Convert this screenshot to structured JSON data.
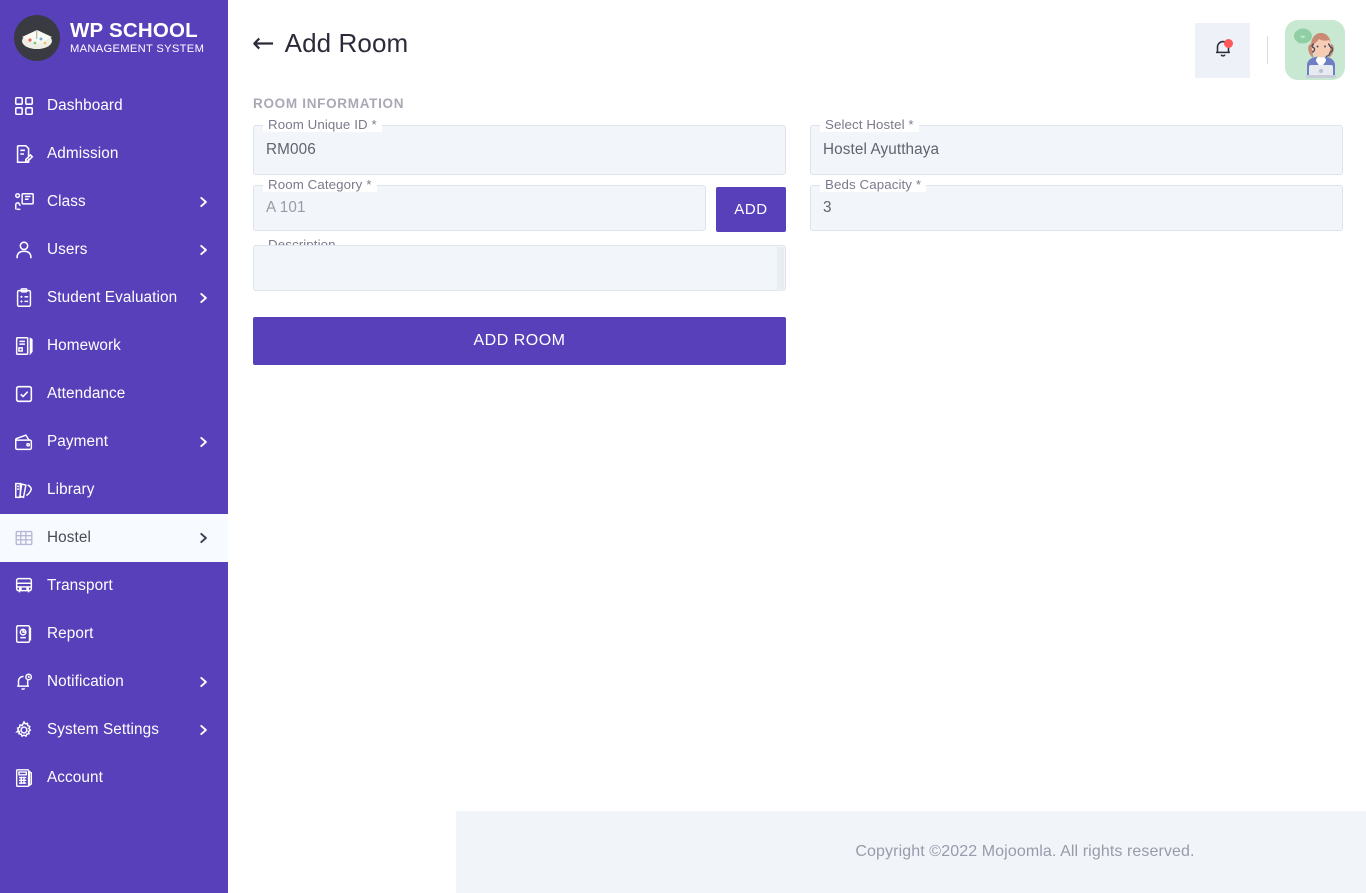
{
  "brand": {
    "title": "WP SCHOOL",
    "subtitle": "MANAGEMENT SYSTEM",
    "logo_icon": "graduation-cap-logo"
  },
  "sidebar": {
    "background_color": "#5840bb",
    "active_background_color": "#f7fbff",
    "items": [
      {
        "label": "Dashboard",
        "icon": "grid-dashboard-icon",
        "has_submenu": false,
        "active": false
      },
      {
        "label": "Admission",
        "icon": "document-edit-icon",
        "has_submenu": false,
        "active": false
      },
      {
        "label": "Class",
        "icon": "teacher-board-icon",
        "has_submenu": true,
        "active": false
      },
      {
        "label": "Users",
        "icon": "user-icon",
        "has_submenu": true,
        "active": false
      },
      {
        "label": "Student Evaluation",
        "icon": "clipboard-check-icon",
        "has_submenu": true,
        "active": false
      },
      {
        "label": "Homework",
        "icon": "notebook-pen-icon",
        "has_submenu": false,
        "active": false
      },
      {
        "label": "Attendance",
        "icon": "checkbox-square-icon",
        "has_submenu": false,
        "active": false
      },
      {
        "label": "Payment",
        "icon": "wallet-icon",
        "has_submenu": true,
        "active": false
      },
      {
        "label": "Library",
        "icon": "books-icon",
        "has_submenu": false,
        "active": false
      },
      {
        "label": "Hostel",
        "icon": "hostel-bed-icon",
        "has_submenu": true,
        "active": true
      },
      {
        "label": "Transport",
        "icon": "bus-icon",
        "has_submenu": false,
        "active": false
      },
      {
        "label": "Report",
        "icon": "report-chart-icon",
        "has_submenu": false,
        "active": false
      },
      {
        "label": "Notification",
        "icon": "bell-clock-icon",
        "has_submenu": true,
        "active": false
      },
      {
        "label": "System Settings",
        "icon": "gear-icon",
        "has_submenu": true,
        "active": false
      },
      {
        "label": "Account",
        "icon": "calculator-icon",
        "has_submenu": false,
        "active": false
      }
    ]
  },
  "topbar": {
    "back_arrow": "←",
    "title": "Add Room",
    "notification_icon": "bell-icon",
    "has_notification_dot": true,
    "avatar_icon": "support-agent-avatar"
  },
  "form": {
    "section_label": "ROOM INFORMATION",
    "fields": {
      "room_unique_id": {
        "label": "Room Unique ID *",
        "value": "RM006",
        "placeholder": ""
      },
      "select_hostel": {
        "label": "Select Hostel *",
        "value": "Hostel Ayutthaya",
        "placeholder": ""
      },
      "room_category": {
        "label": "Room Category *",
        "value": "",
        "placeholder": "A 101"
      },
      "beds_capacity": {
        "label": "Beds Capacity *",
        "value": "3",
        "placeholder": ""
      },
      "description": {
        "label": "Description",
        "value": "",
        "placeholder": ""
      }
    },
    "add_category_button": "ADD",
    "submit_button": "ADD ROOM",
    "accent_color": "#5840bb"
  },
  "footer": {
    "text": "Copyright ©2022 Mojoomla. All rights reserved."
  }
}
